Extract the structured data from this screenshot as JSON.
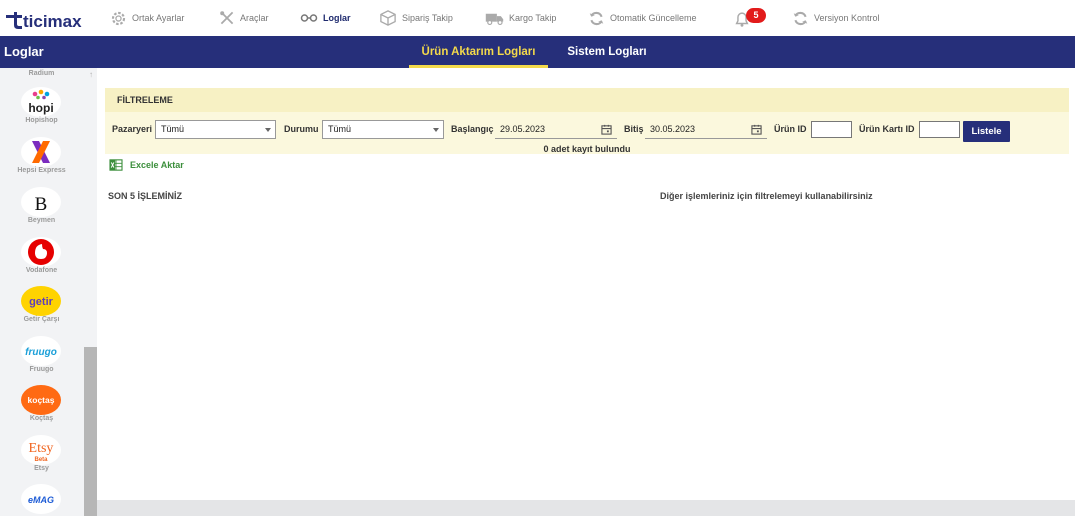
{
  "brand": {
    "logo_text": "ticimax"
  },
  "topnav": {
    "items": [
      {
        "label": "Ortak Ayarlar",
        "icon": "gear-icon"
      },
      {
        "label": "Araçlar",
        "icon": "tools-icon"
      },
      {
        "label": "Loglar",
        "icon": "logs-icon"
      },
      {
        "label": "Sipariş Takip",
        "icon": "box-icon"
      },
      {
        "label": "Kargo Takip",
        "icon": "truck-icon"
      },
      {
        "label": "Otomatik Güncelleme",
        "icon": "refresh-icon"
      },
      {
        "label": "Versiyon Kontrol",
        "icon": "refresh-icon"
      }
    ],
    "notification_count": "5",
    "active_color": "#1e2a6e"
  },
  "header": {
    "title": "Loglar",
    "tabs": [
      {
        "label": "Ürün Aktarım Logları",
        "active": true
      },
      {
        "label": "Sistem Logları",
        "active": false
      }
    ],
    "bar_color": "#262f7a",
    "accent_color": "#f3d94b"
  },
  "sidebar": {
    "top_label": "Radium",
    "items": [
      {
        "label": "Hopishop",
        "logo_text": "hopi"
      },
      {
        "label": "Hepsi Express",
        "logo_text": "X"
      },
      {
        "label": "Beymen",
        "logo_text": "B"
      },
      {
        "label": "Vodafone",
        "logo_text": ""
      },
      {
        "label": "Getir Çarşı",
        "logo_text": "getir"
      },
      {
        "label": "Fruugo",
        "logo_text": "fruugo"
      },
      {
        "label": "Koçtaş",
        "logo_text": "koçtaş"
      },
      {
        "label": "Etsy",
        "logo_text": "Etsy",
        "sub_text": "Beta"
      },
      {
        "label": "",
        "logo_text": "eMAG"
      }
    ]
  },
  "filter": {
    "title": "FİLTRELEME",
    "marketplace_label": "Pazaryeri",
    "marketplace_value": "Tümü",
    "status_label": "Durumu",
    "status_value": "Tümü",
    "start_label": "Başlangıç",
    "start_value": "29.05.2023",
    "end_label": "Bitiş",
    "end_value": "30.05.2023",
    "product_id_label": "Ürün ID",
    "product_card_id_label": "Ürün Kartı ID",
    "list_button": "Listele",
    "result_count": "0 adet kayıt bulundu"
  },
  "actions": {
    "excel_label": "Excele Aktar"
  },
  "content": {
    "last5_title": "SON 5 İŞLEMİNİZ",
    "hint": "Diğer işlemleriniz için filtrelemeyi kullanabilirsiniz"
  }
}
